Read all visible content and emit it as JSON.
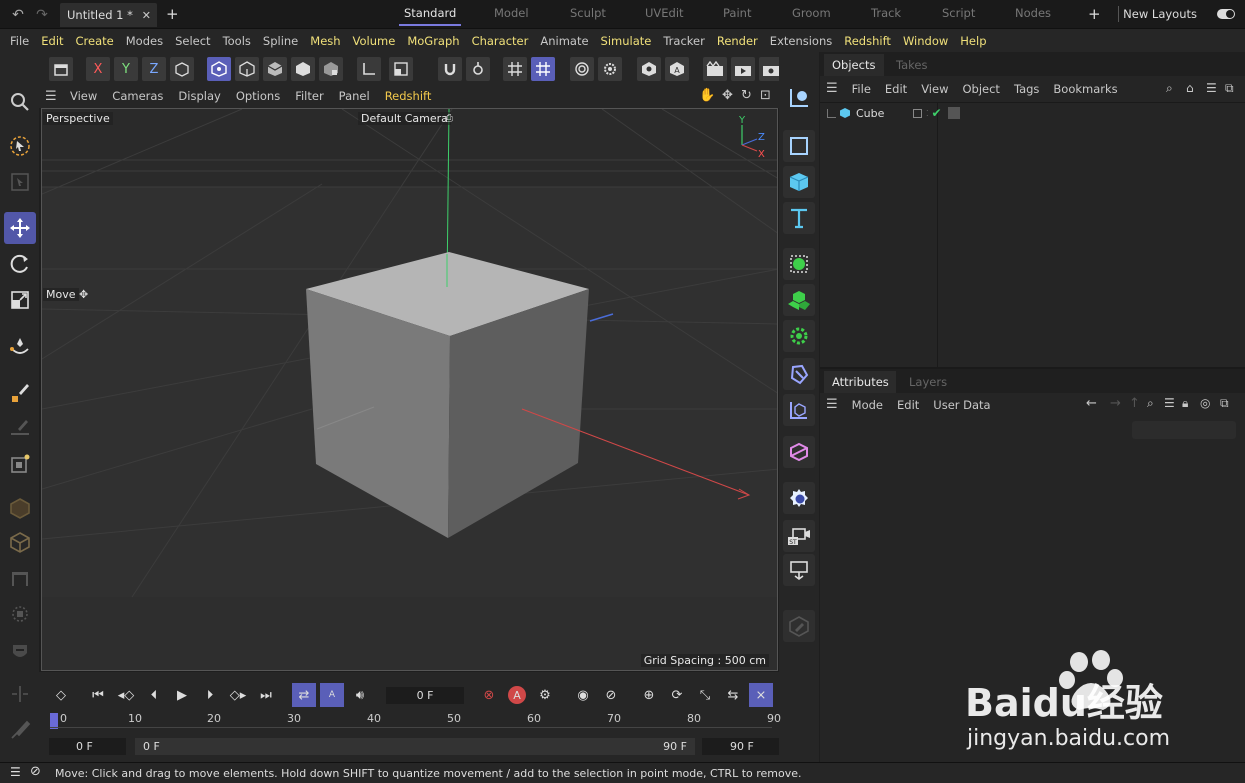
{
  "topbar": {
    "document_tab": "Untitled 1 *",
    "layouts": [
      "Standard",
      "Model",
      "Sculpt",
      "UVEdit",
      "Paint",
      "Groom",
      "Track",
      "Script",
      "Nodes"
    ],
    "active_layout": "Standard",
    "new_layouts": "New Layouts"
  },
  "menubar": [
    "File",
    "Edit",
    "Create",
    "Modes",
    "Select",
    "Tools",
    "Spline",
    "Mesh",
    "Volume",
    "MoGraph",
    "Character",
    "Animate",
    "Simulate",
    "Tracker",
    "Render",
    "Extensions",
    "Redshift",
    "Window",
    "Help"
  ],
  "menubar_highlight": [
    "Edit",
    "Create",
    "Mesh",
    "Volume",
    "MoGraph",
    "Character",
    "Simulate",
    "Render",
    "Redshift",
    "Window",
    "Help"
  ],
  "toolbar": {
    "axis_x": "X",
    "axis_y": "Y",
    "axis_z": "Z"
  },
  "viewport": {
    "menu": [
      "View",
      "Cameras",
      "Display",
      "Options",
      "Filter",
      "Panel",
      "Redshift"
    ],
    "view_name": "Perspective",
    "camera": "Default Camera",
    "tool_hint": "Move",
    "grid_spacing": "Grid Spacing : 500 cm",
    "axis_labels": {
      "y": "Y",
      "z": "Z",
      "x": "X"
    }
  },
  "objects_panel": {
    "tabs": [
      "Objects",
      "Takes"
    ],
    "menu": [
      "File",
      "Edit",
      "View",
      "Object",
      "Tags",
      "Bookmarks"
    ],
    "items": [
      {
        "name": "Cube"
      }
    ]
  },
  "attributes_panel": {
    "tabs": [
      "Attributes",
      "Layers"
    ],
    "menu": [
      "Mode",
      "Edit",
      "User Data"
    ]
  },
  "timeline": {
    "current_frame": "0 F",
    "ticks": [
      "0",
      "10",
      "20",
      "30",
      "40",
      "50",
      "60",
      "70",
      "80",
      "90"
    ],
    "start_field": "0 F",
    "range_start": "0 F",
    "range_end": "90 F",
    "end_field": "90 F"
  },
  "statusbar": {
    "message": "Move: Click and drag to move elements. Hold down SHIFT to quantize movement / add to the selection in point mode, CTRL to remove."
  },
  "watermark": {
    "brand": "Baidu经验",
    "url": "jingyan.baidu.com"
  },
  "colors": {
    "accent": "#5a5fb8",
    "menu_highlight": "#f0e07a",
    "redshift": "#f2c94c"
  }
}
